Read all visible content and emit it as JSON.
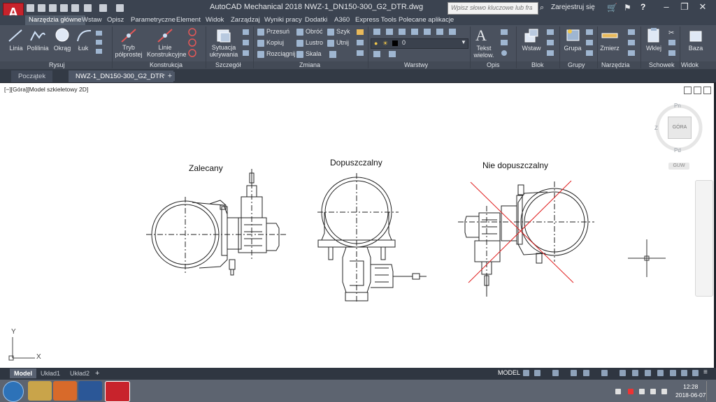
{
  "window": {
    "title": "AutoCAD Mechanical 2018    NWZ-1_DN150-300_G2_DTR.dwg",
    "search_placeholder": "Wpisz słowo kluczowe lub frazę",
    "signin": "Zarejestruj się",
    "help_label": "?",
    "app_button": "A"
  },
  "ribbon_tabs": [
    "Narzędzia główne",
    "Wstaw",
    "Opisz",
    "Parametryczne",
    "Element",
    "Widok",
    "Zarządzaj",
    "Wyniki pracy",
    "Dodatki",
    "A360",
    "Express Tools",
    "Polecane aplikacje"
  ],
  "ribbon": {
    "rysuj": {
      "linia": "Linia",
      "polilinia": "Polilinia",
      "okrag": "Okrąg",
      "luk": "Łuk",
      "label": "Rysuj"
    },
    "konstrukcja": {
      "tryb1": "Tryb",
      "tryb2": "półprostej",
      "linie1": "Linie",
      "linie2": "Konstrukcyjne",
      "label": "Konstrukcja"
    },
    "szczegol": {
      "sytuacja1": "Sytuacja",
      "sytuacja2": "ukrywania",
      "label": "Szczegół"
    },
    "zmiana": {
      "przesun": "Przesuń",
      "kopiuj": "Kopiuj",
      "rozciagnij": "Rozciągnij",
      "obroc": "Obróć",
      "lustro": "Lustro",
      "skala": "Skala",
      "szyk": "Szyk",
      "utnij": "Utnij",
      "label": "Zmiana"
    },
    "warstwy": {
      "layer_value": "0",
      "label": "Warstwy"
    },
    "opis": {
      "tekst1": "Tekst",
      "tekst2": "wielow.",
      "label": "Opis"
    },
    "blok": {
      "wstaw": "Wstaw",
      "label": "Blok"
    },
    "grupy": {
      "grupa": "Grupa",
      "label": "Grupy"
    },
    "narzedzia": {
      "zmierz": "Zmierz",
      "label": "Narzędzia"
    },
    "schowek": {
      "wklej": "Wklej",
      "label": "Schowek"
    },
    "widok": {
      "baza": "Baza",
      "label": "Widok"
    }
  },
  "doc_tabs": {
    "start": "Początek",
    "drawing": "NWZ-1_DN150-300_G2_DTR*",
    "plus": "+"
  },
  "viewport": {
    "label": "[−][Góra][Model szkieletowy 2D]"
  },
  "drawing": {
    "captions": {
      "recommended": "Zalecany",
      "acceptable": "Dopuszczalny",
      "not_acceptable": "Nie dopuszczalny"
    },
    "ucs": {
      "x": "X",
      "y": "Y"
    }
  },
  "viewcube": {
    "north": "Pn",
    "south": "Pd",
    "west": "Z",
    "face": "GÓRA",
    "wcs": "GUW"
  },
  "layout_tabs": [
    "Model",
    "Układ1",
    "Układ2"
  ],
  "status": {
    "mode": "MODEL"
  },
  "taskbar": {
    "time": "12:28",
    "date": "2018-06-07"
  },
  "colors": {
    "cross_out": "#e02020",
    "ribbon_bg": "#4a515e",
    "app_red": "#c8232c"
  }
}
